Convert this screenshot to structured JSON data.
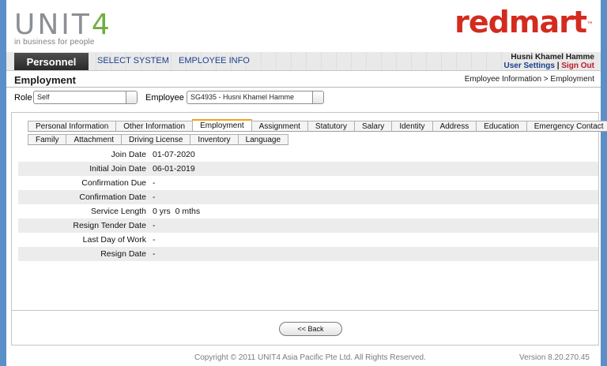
{
  "header": {
    "unit4_logo_text": "UNIT",
    "unit4_logo_num": "4",
    "unit4_tagline": "in business for people",
    "redmart_logo": "redmart",
    "redmart_tm": "™"
  },
  "nav": {
    "active_tab": "Personnel",
    "links": [
      "SELECT SYSTEM",
      "EMPLOYEE INFO"
    ],
    "user_name": "Husni Khamel Hamme",
    "user_settings": "User Settings",
    "separator": " | ",
    "sign_out": "Sign Out"
  },
  "page": {
    "title": "Employment",
    "breadcrumb": "Employee Information  >  Employment"
  },
  "filters": {
    "role_label": "Role",
    "role_value": "Self",
    "employee_label": "Employee",
    "employee_value": "SG4935 - Husni Khamel Hamme"
  },
  "tabs_row1": [
    "Personal Information",
    "Other Information",
    "Employment",
    "Assignment",
    "Statutory",
    "Salary",
    "Identity",
    "Address",
    "Education",
    "Emergency Contact"
  ],
  "tabs_row2": [
    "Family",
    "Attachment",
    "Driving License",
    "Inventory",
    "Language"
  ],
  "active_tab_index": 2,
  "fields": [
    {
      "label": "Join Date",
      "value": "01-07-2020"
    },
    {
      "label": "Initial Join Date",
      "value": "06-01-2019"
    },
    {
      "label": "Confirmation Due",
      "value": "-"
    },
    {
      "label": "Confirmation Date",
      "value": "-"
    },
    {
      "label": "Service Length",
      "value": "0 yrs  0 mths"
    },
    {
      "label": "Resign Tender Date",
      "value": "-"
    },
    {
      "label": "Last Day of Work",
      "value": "-"
    },
    {
      "label": "Resign Date",
      "value": "-"
    }
  ],
  "back_button": "<< Back",
  "footer": {
    "copyright": "Copyright © 2011 UNIT4 Asia Pacific Pte Ltd. All Rights Reserved.",
    "version": "Version 8.20.270.45"
  },
  "colors": {
    "unit4_green": "#6fae3f",
    "redmart_red": "#d32b1e",
    "active_tab_accent": "#f2a21d",
    "link_blue": "#1a3f8a",
    "signout_red": "#c0182a",
    "outer_background": "#5a8fc8"
  }
}
